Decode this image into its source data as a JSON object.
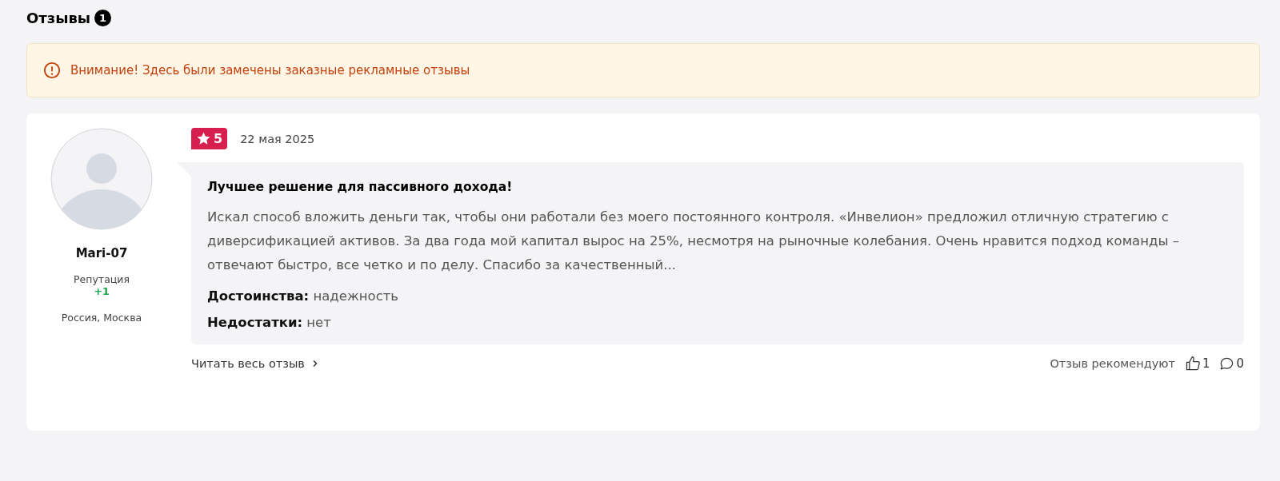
{
  "section": {
    "title": "Отзывы",
    "count": "1"
  },
  "alert": {
    "text": "Внимание! Здесь были замечены заказные рекламные отзывы"
  },
  "reviews": [
    {
      "author": {
        "name": "Mari-07",
        "reputation_label": "Репутация",
        "reputation": "+1",
        "location": "Россия, Москва"
      },
      "rating": "5",
      "date": "22 мая 2025",
      "title": "Лучшее решение для пассивного дохода!",
      "text": "Искал способ вложить деньги так, чтобы они работали без моего постоянного контроля. «Инвелион» предложил отличную стратегию с диверсификацией активов. За два года мой капитал вырос на 25%, несмотря на рыночные колебания. Очень нравится подход команды – отвечают быстро, все четко и по делу. Спасибо за качественный...",
      "pros": "**Достоинства:** надежность",
      "cons": "**Недостатки:** нет",
      "read_more": "Читать весь отзыв",
      "recommend_label": "Отзыв рекомендуют",
      "likes": "1",
      "comments": "0"
    }
  ]
}
